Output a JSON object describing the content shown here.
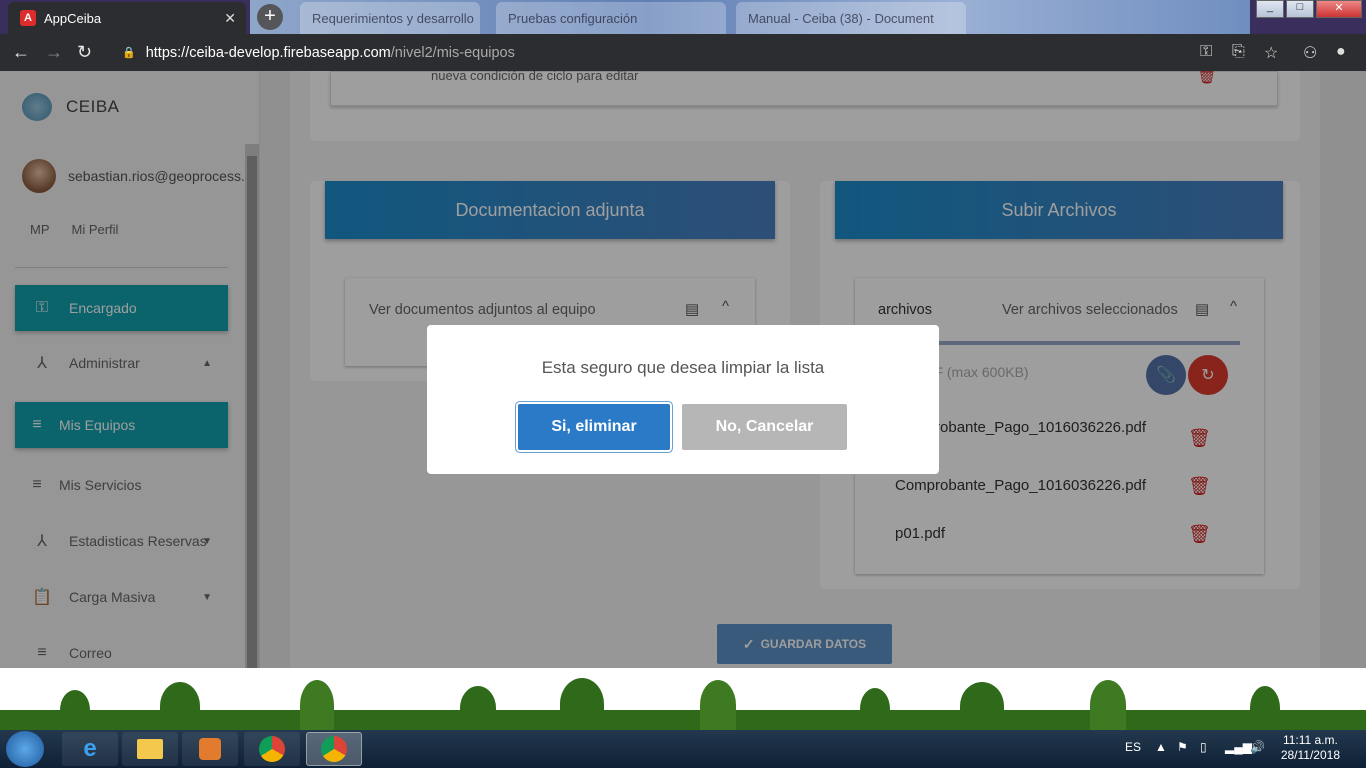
{
  "browser": {
    "active_tab": {
      "favicon": "A",
      "title": "AppCeiba"
    },
    "background_tabs": [
      {
        "title": "Requerimientos y desarrollo"
      },
      {
        "title": "Pruebas configuración"
      },
      {
        "title": "Manual - Ceiba (38) - Document"
      }
    ],
    "url_host": "https://ceiba-develop.firebaseapp.com",
    "url_path": "/nivel2/mis-equipos",
    "window_buttons": {
      "minimize": "_",
      "maximize": "□",
      "close": "✕"
    }
  },
  "sidebar": {
    "brand": "CEIBA",
    "user_email": "sebastian.rios@geoprocess.com",
    "profile_initials": "MP",
    "profile_label": "Mi Perfil",
    "items": [
      {
        "label": "Encargado",
        "icon": "key-icon",
        "active": true
      },
      {
        "label": "Administrar",
        "icon": "hierarchy-icon",
        "active": false,
        "caret": "▲"
      },
      {
        "label": "Mis Equipos",
        "icon": "list-icon",
        "active": true
      },
      {
        "label": "Mis Servicios",
        "icon": "list-icon",
        "active": false
      },
      {
        "label": "Estadisticas Reservas",
        "icon": "hierarchy-icon",
        "active": false,
        "caret": "▼"
      },
      {
        "label": "Carga Masiva",
        "icon": "clipboard-icon",
        "active": false,
        "caret": "▼"
      },
      {
        "label": "Correo",
        "icon": "list-icon",
        "active": false
      }
    ]
  },
  "main": {
    "top_card_text": "nueva condición de ciclo para editar",
    "doc_panel": {
      "title": "Documentacion adjunta",
      "expander_label": "Ver documentos adjuntos al equipo",
      "chevron": "^"
    },
    "upload_panel": {
      "title": "Subir Archivos",
      "tab_label": "archivos",
      "expander_label": "Ver archivos seleccionados",
      "chevron": "^",
      "file_hint": "PDF (max 600KB)",
      "files": [
        "Comprobante_Pago_1016036226.pdf",
        "Comprobante_Pago_1016036226.pdf",
        "p01.pdf"
      ]
    },
    "save_button": "GUARDAR DATOS"
  },
  "dialog": {
    "message": "Esta seguro que desea limpiar la lista",
    "confirm": "Si, eliminar",
    "cancel": "No, Cancelar"
  },
  "taskbar": {
    "language": "ES",
    "time": "11:11 a.m.",
    "date": "28/11/2018"
  },
  "colors": {
    "accent_teal": "#13a1ae",
    "header_blue": "#1c8dcc",
    "confirm_blue": "#2b7ac8",
    "delete_red": "#d32020"
  }
}
